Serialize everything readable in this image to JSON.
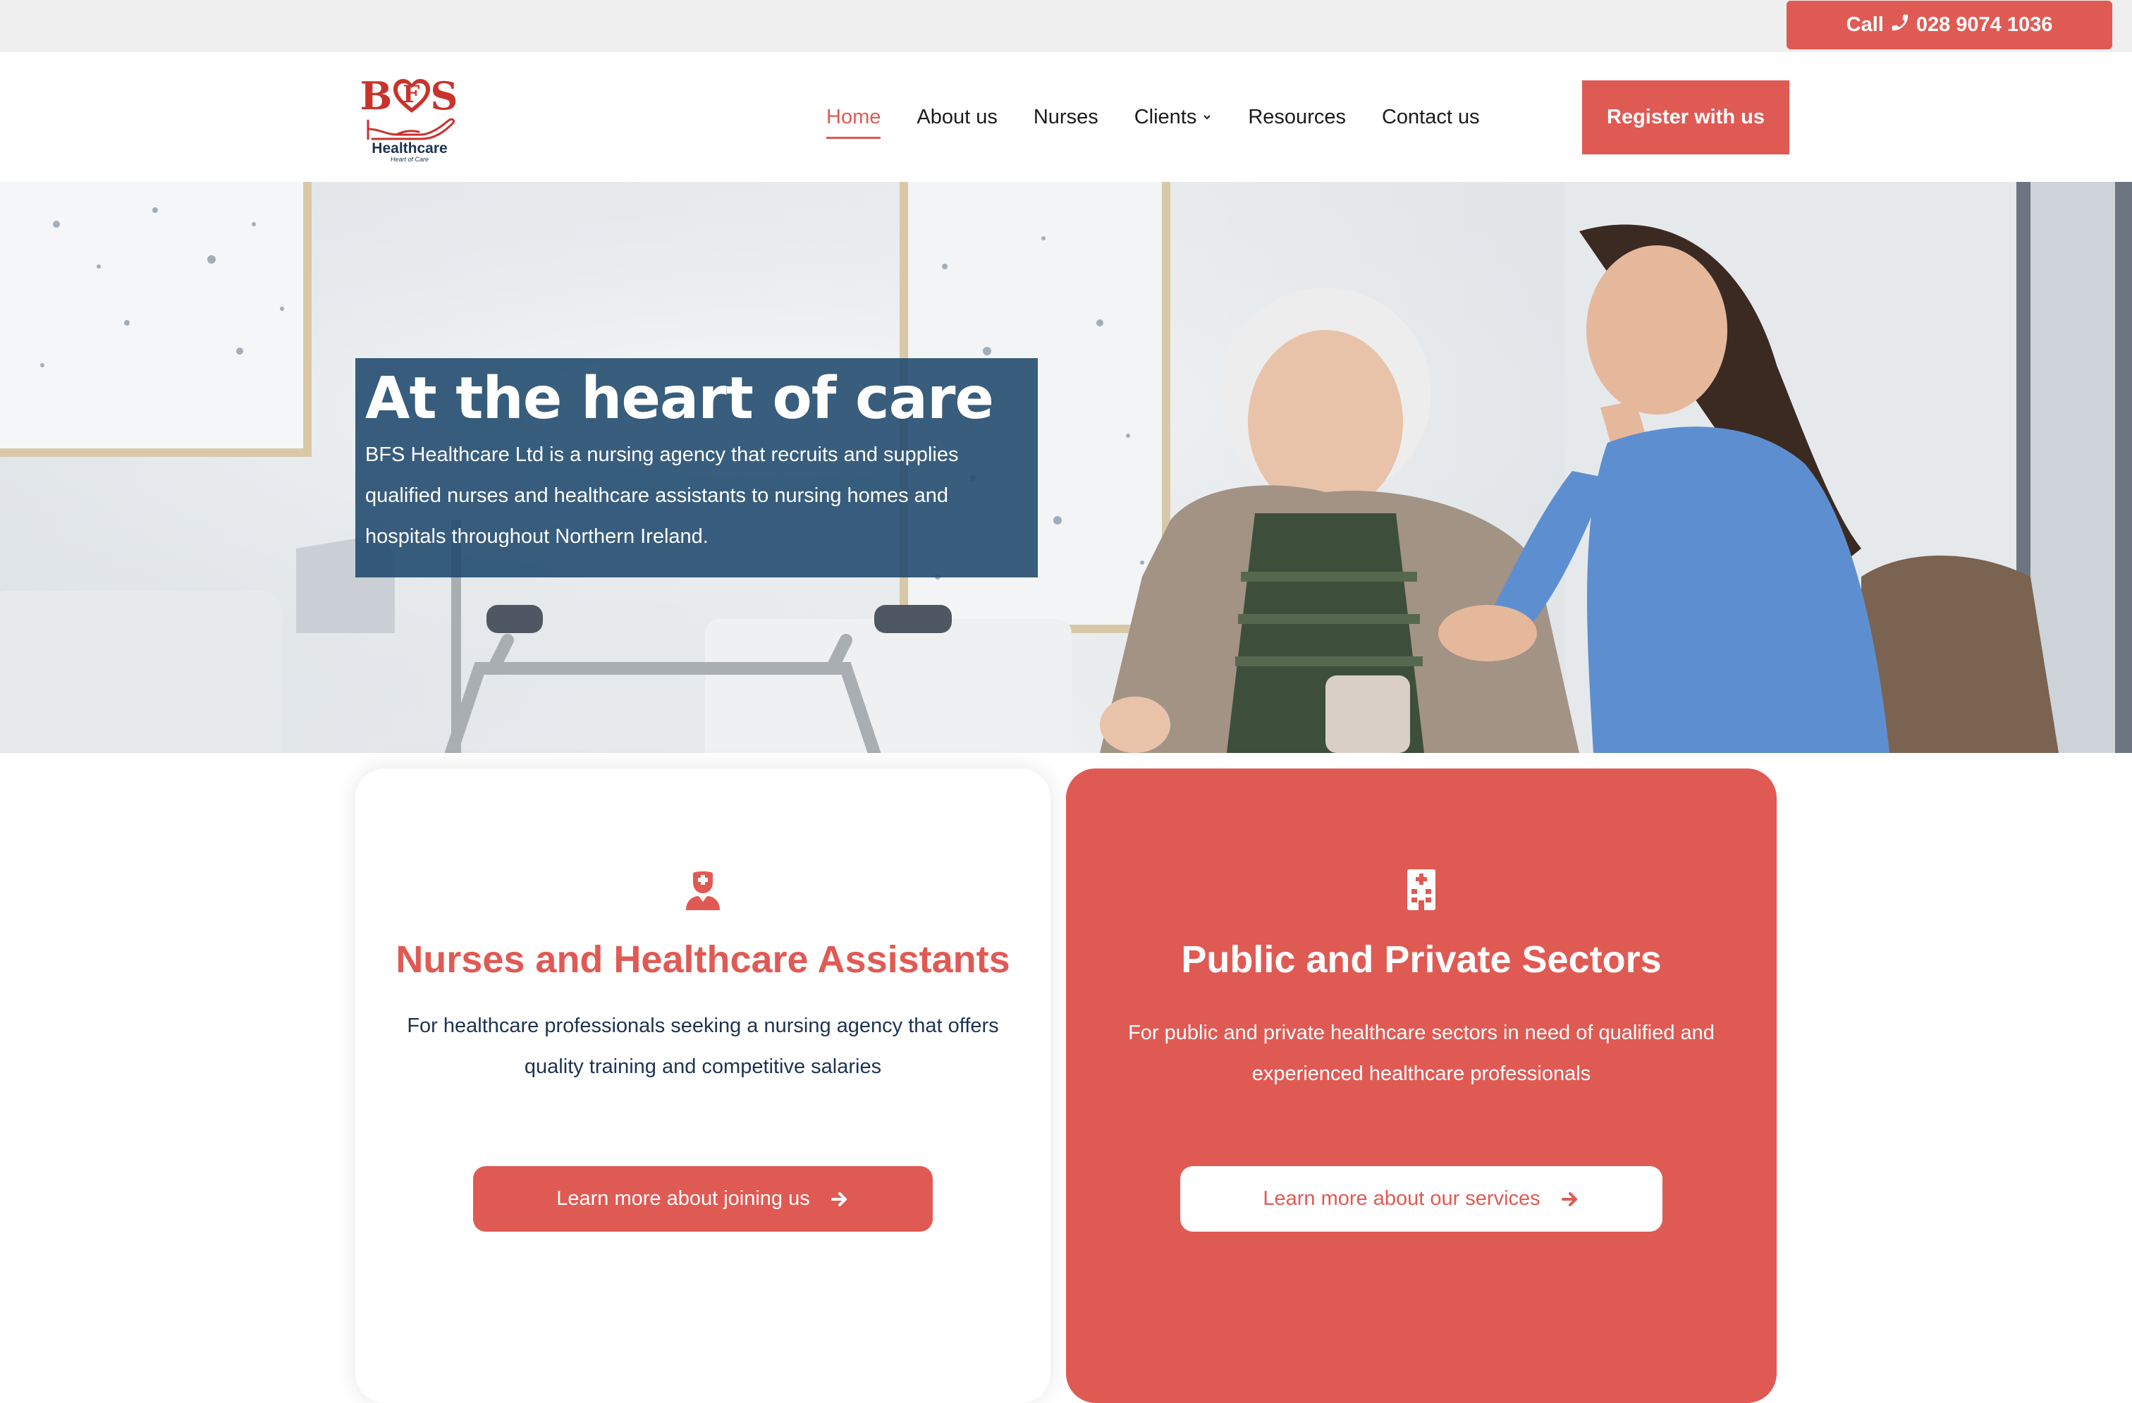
{
  "topbar": {
    "call_label": "Call",
    "phone": "028 9074 1036",
    "phone_icon": "phone-icon"
  },
  "header": {
    "logo": {
      "letters_left": "B",
      "letters_heart": "F",
      "letters_right": "S",
      "name": "Healthcare",
      "tagline": "Heart of Care"
    },
    "nav": [
      {
        "label": "Home",
        "active": true
      },
      {
        "label": "About us"
      },
      {
        "label": "Nurses"
      },
      {
        "label": "Clients",
        "has_dropdown": true
      },
      {
        "label": "Resources"
      },
      {
        "label": "Contact us"
      }
    ],
    "register_label": "Register with us"
  },
  "hero": {
    "title": "At the heart of care",
    "text": "BFS Healthcare Ltd is a nursing agency that recruits and supplies qualified nurses and healthcare assistants to nursing homes and hospitals throughout Northern Ireland."
  },
  "cards": [
    {
      "icon": "nurse-icon",
      "title": "Nurses and Healthcare Assistants",
      "text": "For healthcare professionals seeking a nursing agency that offers quality training and competitive salaries",
      "button_label": "Learn more about joining us",
      "button_icon": "arrow-right-icon"
    },
    {
      "icon": "hospital-icon",
      "title": "Public and Private Sectors",
      "text": "For public and private healthcare sectors in need of qualified and experienced healthcare professionals",
      "button_label": "Learn more about our services",
      "button_icon": "arrow-right-icon"
    }
  ],
  "colors": {
    "accent": "#e05a54",
    "navy": "#1e3350",
    "hero_box": "#1e486c",
    "topbar_bg": "#efefef"
  }
}
